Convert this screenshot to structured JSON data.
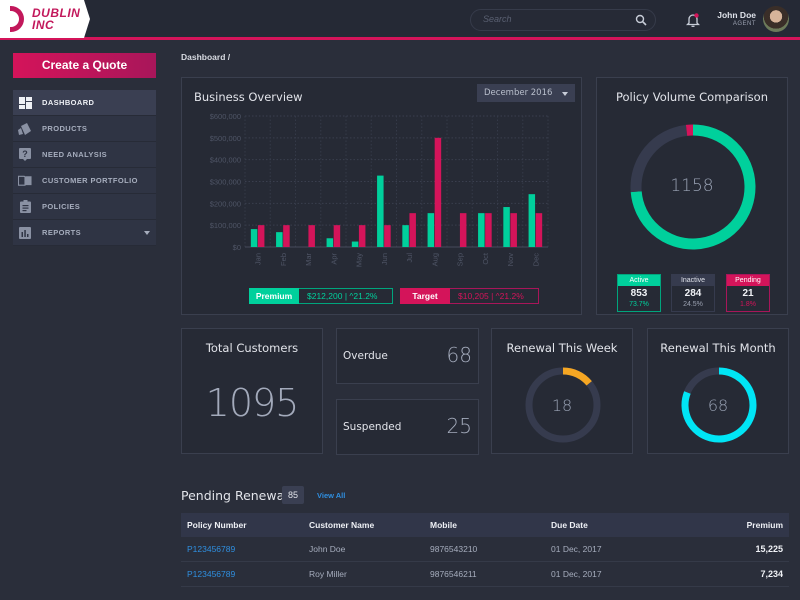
{
  "brand": {
    "line1": "DUBLIN",
    "line2": "INC"
  },
  "header": {
    "search_placeholder": "Search",
    "user_name": "John Doe",
    "user_role": "AGENT",
    "has_notification": true
  },
  "sidebar": {
    "cta_label": "Create a Quote",
    "items": [
      {
        "label": "DASHBOARD",
        "icon": "dashboard-icon",
        "active": true
      },
      {
        "label": "PRODUCTS",
        "icon": "products-icon",
        "active": false
      },
      {
        "label": "NEED ANALYSIS",
        "icon": "question-icon",
        "active": false
      },
      {
        "label": "CUSTOMER PORTFOLIO",
        "icon": "book-icon",
        "active": false
      },
      {
        "label": "POLICIES",
        "icon": "clipboard-icon",
        "active": false
      },
      {
        "label": "REPORTS",
        "icon": "bar-chart-icon",
        "active": false,
        "has_submenu": true
      }
    ]
  },
  "breadcrumb": "Dashboard /",
  "business_overview": {
    "title": "Business Overview",
    "period": "December 2016",
    "premium_label": "Premium",
    "premium_value": "$212,200 | ^21.2%",
    "target_label": "Target",
    "target_value": "$10,205 | ^21.2%"
  },
  "policy_volume": {
    "title": "Policy Volume Comparison",
    "total": "1158",
    "stats": [
      {
        "label": "Active",
        "count": "853",
        "pct": "73.7%",
        "fraction": 0.737
      },
      {
        "label": "Inactive",
        "count": "284",
        "pct": "24.5%",
        "fraction": 0.245
      },
      {
        "label": "Pending",
        "count": "21",
        "pct": "1.8%",
        "fraction": 0.018
      }
    ]
  },
  "total_customers": {
    "title": "Total Customers",
    "value": "1095"
  },
  "overdue": {
    "label": "Overdue",
    "value": "68"
  },
  "suspended": {
    "label": "Suspended",
    "value": "25"
  },
  "renewal_week": {
    "title": "Renewal This Week",
    "value": "18",
    "fraction": 0.14
  },
  "renewal_month": {
    "title": "Renewal This Month",
    "value": "68",
    "fraction": 0.81
  },
  "pending_renewal": {
    "title": "Pending Renewal",
    "count": "85",
    "view_all": "View All",
    "columns": [
      "Policy Number",
      "Customer Name",
      "Mobile",
      "Due Date",
      "Premium"
    ],
    "rows": [
      [
        "P123456789",
        "John Doe",
        "9876543210",
        "01 Dec, 2017",
        "15,225"
      ],
      [
        "P123456789",
        "Roy Miller",
        "9876546211",
        "01 Dec, 2017",
        "7,234"
      ]
    ]
  },
  "colors": {
    "accent": "#d4145a",
    "premium": "#00d09c",
    "target": "#d4145a",
    "inactive": "#363b4e",
    "week_ring": "#f5a623",
    "month_ring": "#00e5f5",
    "link": "#2f8fe0"
  },
  "chart_data": {
    "type": "bar",
    "title": "Business Overview",
    "categories": [
      "Jan",
      "Feb",
      "Mar",
      "Apr",
      "May",
      "Jun",
      "Jul",
      "Aug",
      "Sep",
      "Oct",
      "Nov",
      "Dec"
    ],
    "series": [
      {
        "name": "Premium",
        "color": "#00d09c",
        "values": [
          82000,
          68000,
          0,
          40000,
          25000,
          327000,
          100000,
          155000,
          0,
          155000,
          183000,
          242000
        ]
      },
      {
        "name": "Target",
        "color": "#d4145a",
        "values": [
          100000,
          100000,
          100000,
          100000,
          100000,
          100000,
          155000,
          500000,
          155000,
          155000,
          155000,
          155000
        ]
      }
    ],
    "yticks": [
      "$0",
      "$100,000",
      "$200,000",
      "$300,000",
      "$400,000",
      "$500,000",
      "$600,000"
    ],
    "ylim": [
      0,
      600000
    ],
    "xlabel": "",
    "ylabel": "",
    "grid": true,
    "legend": "bottom"
  }
}
